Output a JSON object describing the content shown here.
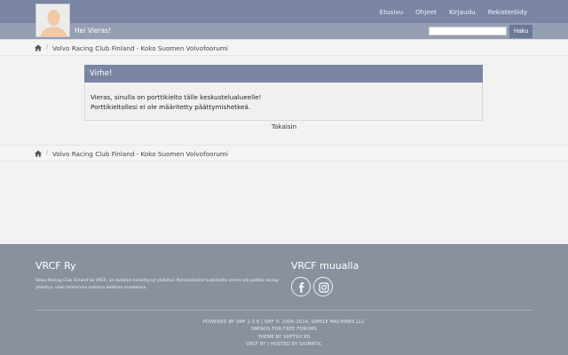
{
  "header": {
    "greeting": "Hei Vieras!",
    "nav": [
      "Etusivu",
      "Ohjeet",
      "Kirjaudu",
      "Rekisteröidy"
    ],
    "search_placeholder": "",
    "search_button": "Haku"
  },
  "breadcrumb": {
    "label": "Volvo Racing Club Finland - Koko Suomen Volvofoorumi"
  },
  "error": {
    "title": "Virhe!",
    "line1": "Vieras, sinulla on porttikielto tälle keskustelualueelle!",
    "line2": "Porttikieltollesi ei ole määritetty päättymishetkeä.",
    "back": "Takaisin"
  },
  "footer": {
    "title_left": "VRCF Ry",
    "description": "Volvo Racing Club Finland tai VRCF, on autoilun keskittynyt yhdistys. Nimestämme huolimatta emme ole pelkkä racing-yhdistys, vaan toimimme autoilun kaikissa muodoissa.",
    "title_right": "VRCF muualla",
    "credits": [
      "POWERED BY SMF 2.0.8 | SMF © 2006–2014, SIMPLE MACHINES LLC",
      "SMFADS FOR FREE FORUMS",
      "THEME BY SMFTRICKS",
      "VRCF RY | HOSTED BY SIGMATIC"
    ]
  },
  "colors": {
    "header": "#7a85a3",
    "subbar": "#959eb3",
    "footer": "#8a919e"
  },
  "icons": [
    "home-icon",
    "facebook-icon",
    "instagram-icon",
    "avatar-icon"
  ]
}
